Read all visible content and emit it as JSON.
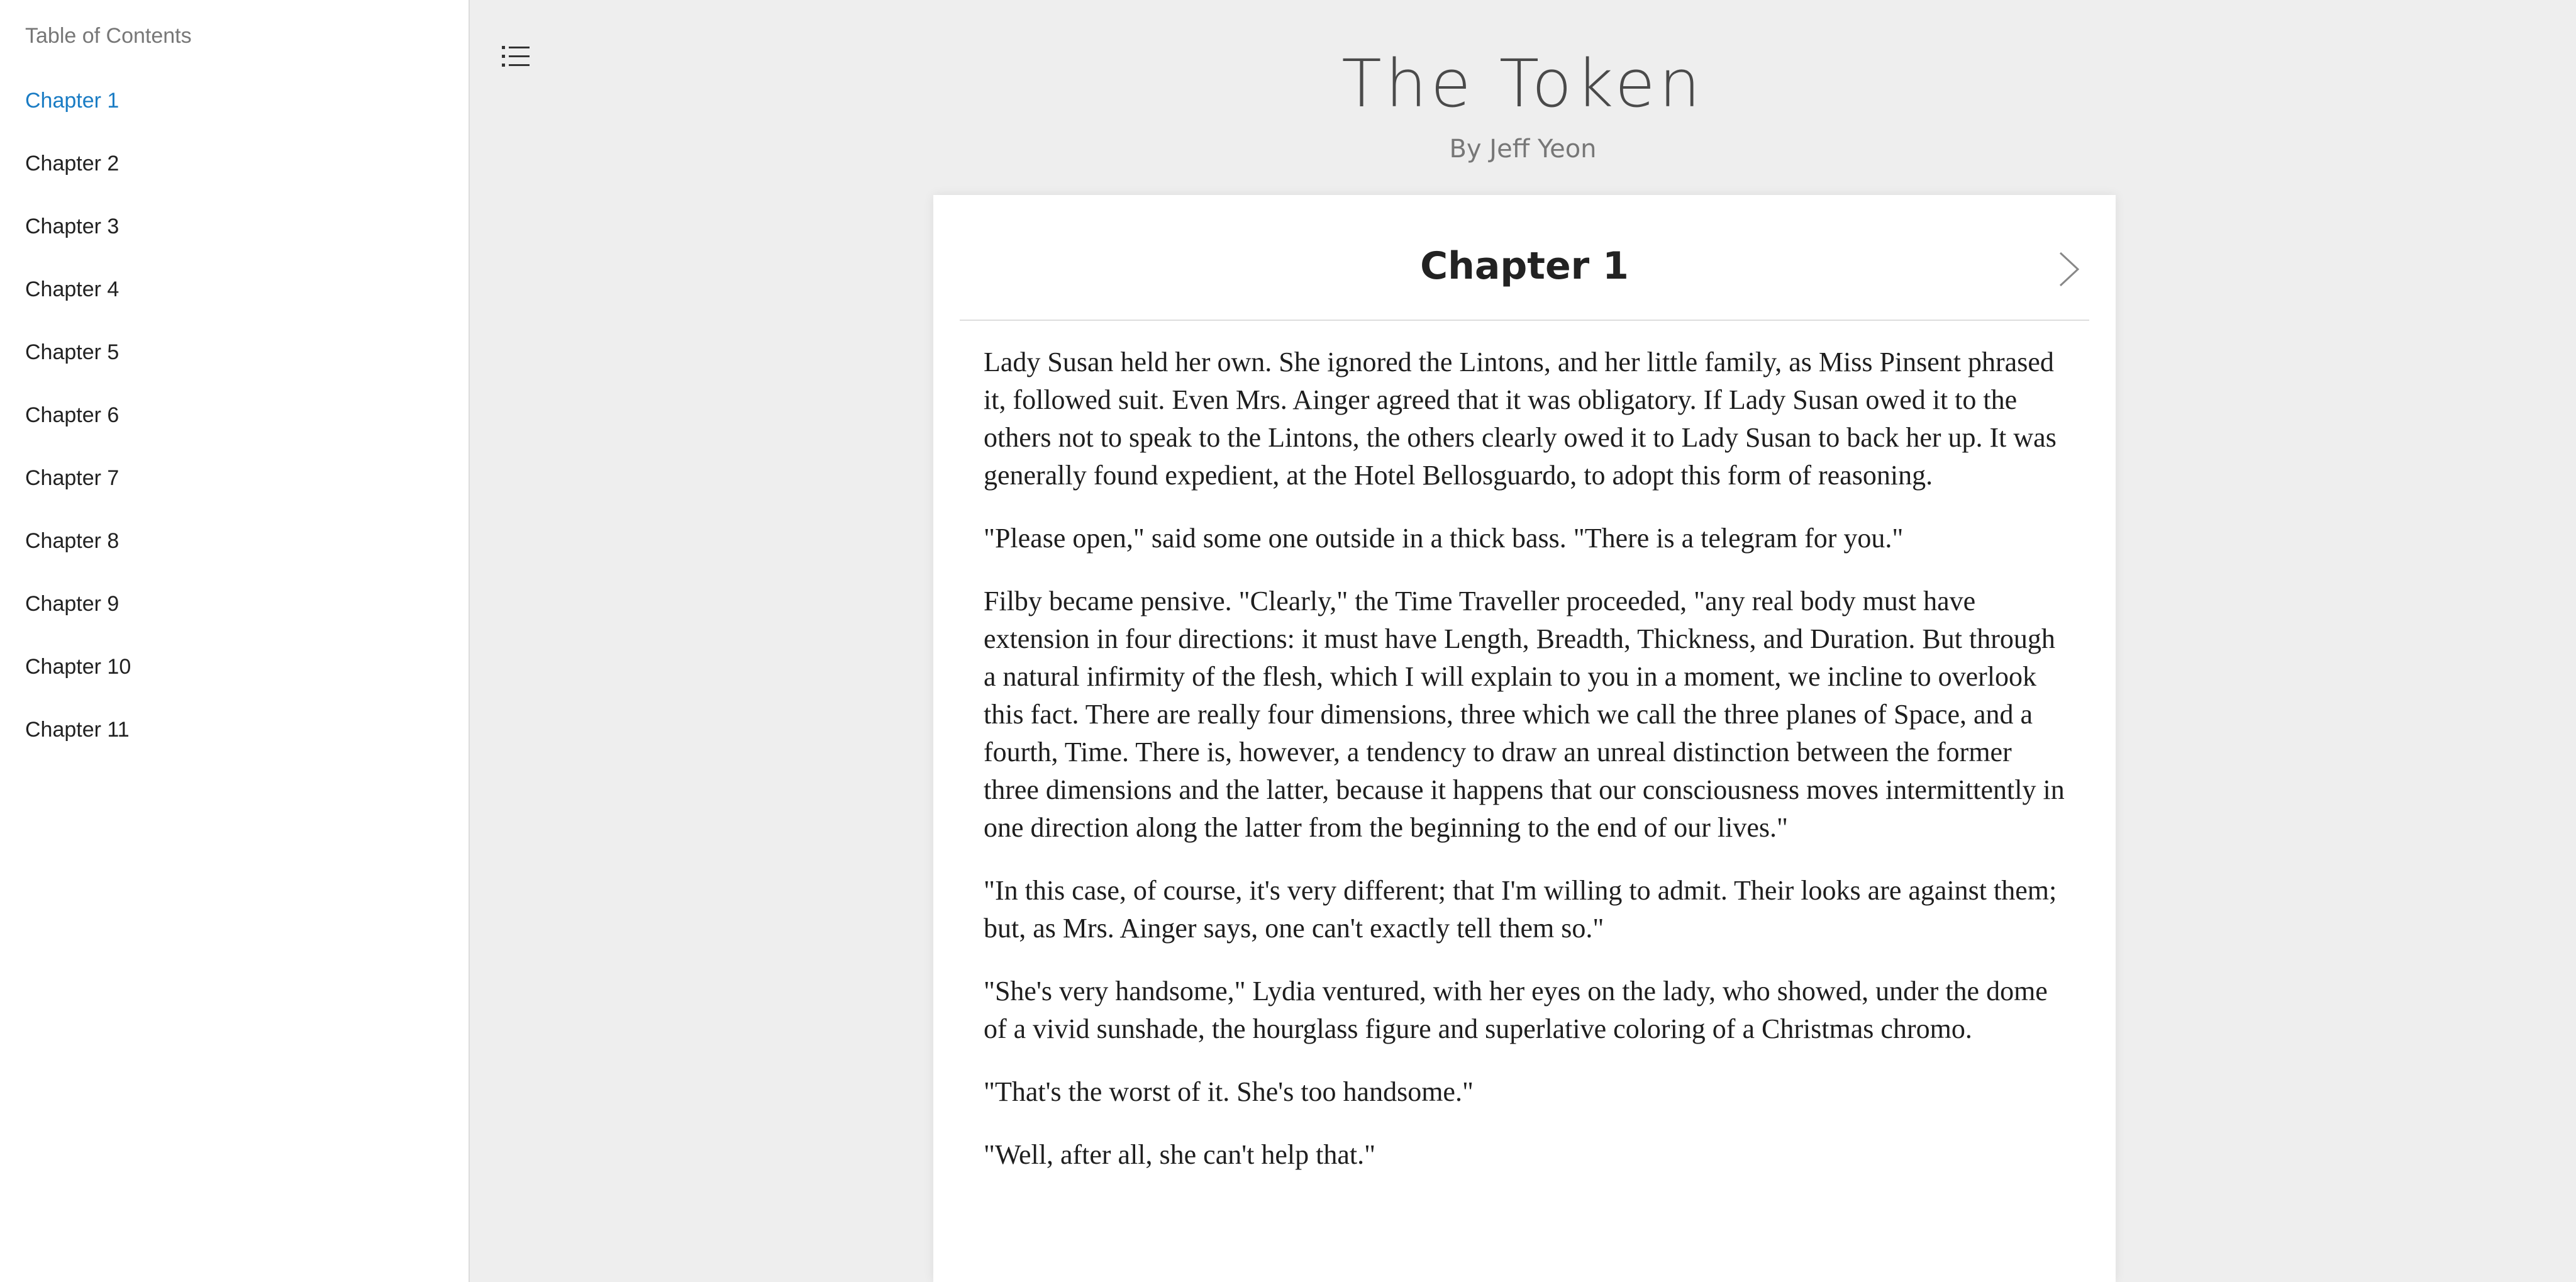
{
  "sidebar": {
    "title": "Table of Contents",
    "items": [
      {
        "label": "Chapter 1"
      },
      {
        "label": "Chapter 2"
      },
      {
        "label": "Chapter 3"
      },
      {
        "label": "Chapter 4"
      },
      {
        "label": "Chapter 5"
      },
      {
        "label": "Chapter 6"
      },
      {
        "label": "Chapter 7"
      },
      {
        "label": "Chapter 8"
      },
      {
        "label": "Chapter 9"
      },
      {
        "label": "Chapter 10"
      },
      {
        "label": "Chapter 11"
      }
    ],
    "active_index": 0
  },
  "header": {
    "menu_icon": "list-icon",
    "title": "The Token",
    "author": "By Jeff Yeon"
  },
  "chapter": {
    "title": "Chapter 1",
    "next_icon": "chevron-right-icon",
    "paragraphs": [
      "Lady Susan held her own. She ignored the Lintons, and her little family, as Miss Pinsent phrased it, followed suit. Even Mrs. Ainger agreed that it was obligatory. If Lady Susan owed it to the others not to speak to the Lintons, the others clearly owed it to Lady Susan to back her up. It was generally found expedient, at the Hotel Bellosguardo, to adopt this form of reasoning.",
      "\"Please open,\" said some one outside in a thick bass. \"There is a telegram for you.\"",
      "Filby became pensive. \"Clearly,\" the Time Traveller proceeded, \"any real body must have extension in four directions: it must have Length, Breadth, Thickness, and Duration. But through a natural infirmity of the flesh, which I will explain to you in a moment, we incline to overlook this fact. There are really four dimensions, three which we call the three planes of Space, and a fourth, Time. There is, however, a tendency to draw an unreal distinction between the former three dimensions and the latter, because it happens that our consciousness moves intermittently in one direction along the latter from the beginning to the end of our lives.\"",
      "\"In this case, of course, it's very different; that I'm willing to admit. Their looks are against them; but, as Mrs. Ainger says, one can't exactly tell them so.\"",
      "\"She's very handsome,\" Lydia ventured, with her eyes on the lady, who showed, under the dome of a vivid sunshade, the hourglass figure and superlative coloring of a Christmas chromo.",
      "\"That's the worst of it. She's too handsome.\"",
      "\"Well, after all, she can't help that.\""
    ]
  },
  "colors": {
    "active_link": "#1a7cc4",
    "background": "#eeeeee"
  }
}
